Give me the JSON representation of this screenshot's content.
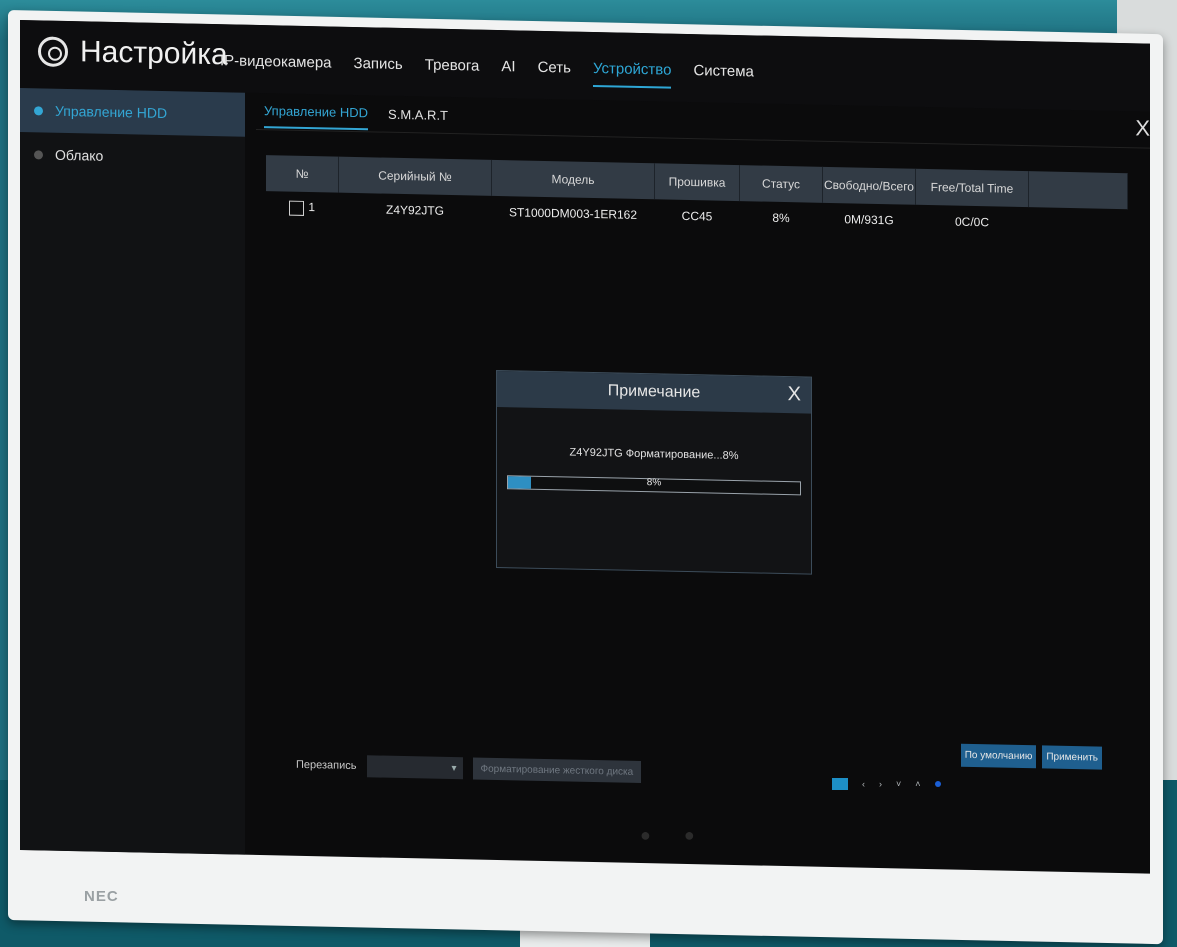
{
  "header": {
    "title": "Настройка",
    "nav": [
      "IP-видеокамера",
      "Запись",
      "Тревога",
      "AI",
      "Сеть",
      "Устройство",
      "Система"
    ],
    "active_nav": "Устройство"
  },
  "sidebar": {
    "items": [
      {
        "label": "Управление HDD",
        "active": true
      },
      {
        "label": "Облако",
        "active": false
      }
    ]
  },
  "subtabs": [
    "Управление HDD",
    "S.M.A.R.T"
  ],
  "close_symbol": "X",
  "table": {
    "headers": [
      "№",
      "Серийный №",
      "Модель",
      "Прошивка",
      "Статус",
      "Свободно/Всего",
      "Free/Total Time",
      ""
    ],
    "rows": [
      {
        "no": "1",
        "serial": "Z4Y92JTG",
        "model": "ST1000DM003-1ER162",
        "firmware": "CC45",
        "status": "8%",
        "free_total": "0M/931G",
        "free_total_time": "0C/0C"
      }
    ]
  },
  "bottom": {
    "overwrite_label": "Перезапись",
    "format_button": "Форматирование жесткого диска",
    "default_button": "По умолчанию",
    "apply_button": "Применить"
  },
  "modal": {
    "title": "Примечание",
    "message": "Z4Y92JTG Форматирование...8%",
    "progress_label": "8%",
    "progress_fraction": 0.08
  },
  "bezel": {
    "brand": "NEC"
  },
  "colors": {
    "accent": "#2ea7d6",
    "header_bg": "#2c3a48",
    "progress": "#2e8fc2"
  }
}
